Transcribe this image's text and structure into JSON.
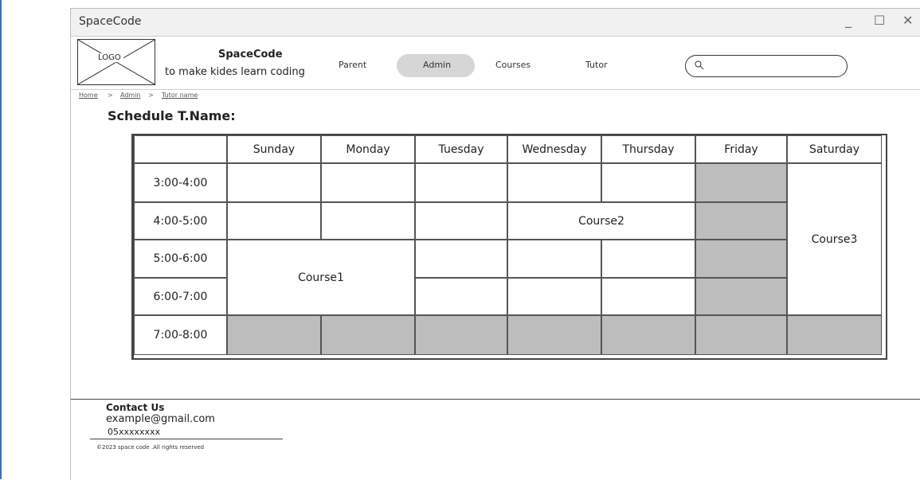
{
  "window": {
    "title": "SpaceCode",
    "controls": {
      "minimize": "_",
      "maximize": "☐",
      "close": "✕"
    }
  },
  "header": {
    "logo_text": "LOGO",
    "brand_name": "SpaceCode",
    "tagline": "to make kides learn coding",
    "nav": [
      "Parent",
      "Admin",
      "Courses",
      "Tutor"
    ],
    "active_nav": "Admin",
    "search": {
      "value": "",
      "placeholder": "",
      "icon": "search-icon"
    }
  },
  "breadcrumb": {
    "items": [
      "Home",
      "Admin",
      "Tutor name"
    ],
    "separator": ">"
  },
  "page_title": "Schedule T.Name:",
  "schedule": {
    "days": [
      "Sunday",
      "Monday",
      "Tuesday",
      "Wednesday",
      "Thursday",
      "Friday",
      "Saturday"
    ],
    "times": [
      "3:00-4:00",
      "4:00-5:00",
      "5:00-6:00",
      "6:00-7:00",
      "7:00-8:00"
    ],
    "blocks": [
      {
        "label": "Course1",
        "day": "Sunday",
        "day_span": 2,
        "start_slot": "5:00-6:00",
        "slot_span": 2
      },
      {
        "label": "Course2",
        "day": "Wednesday",
        "day_span": 2,
        "start_slot": "4:00-5:00",
        "slot_span": 1
      },
      {
        "label": "Course3",
        "day": "Saturday",
        "day_span": 1,
        "start_slot": "3:00-4:00",
        "slot_span": 4
      }
    ],
    "unavailable_day": "Friday",
    "unavailable_slot": "7:00-8:00",
    "unavailable_color": "#bdbdbd"
  },
  "footer": {
    "contact_title": "Contact Us",
    "email": "example@gmail.com",
    "phone": "05xxxxxxxx",
    "copyright": "©2023 space code .All rights reserved"
  }
}
